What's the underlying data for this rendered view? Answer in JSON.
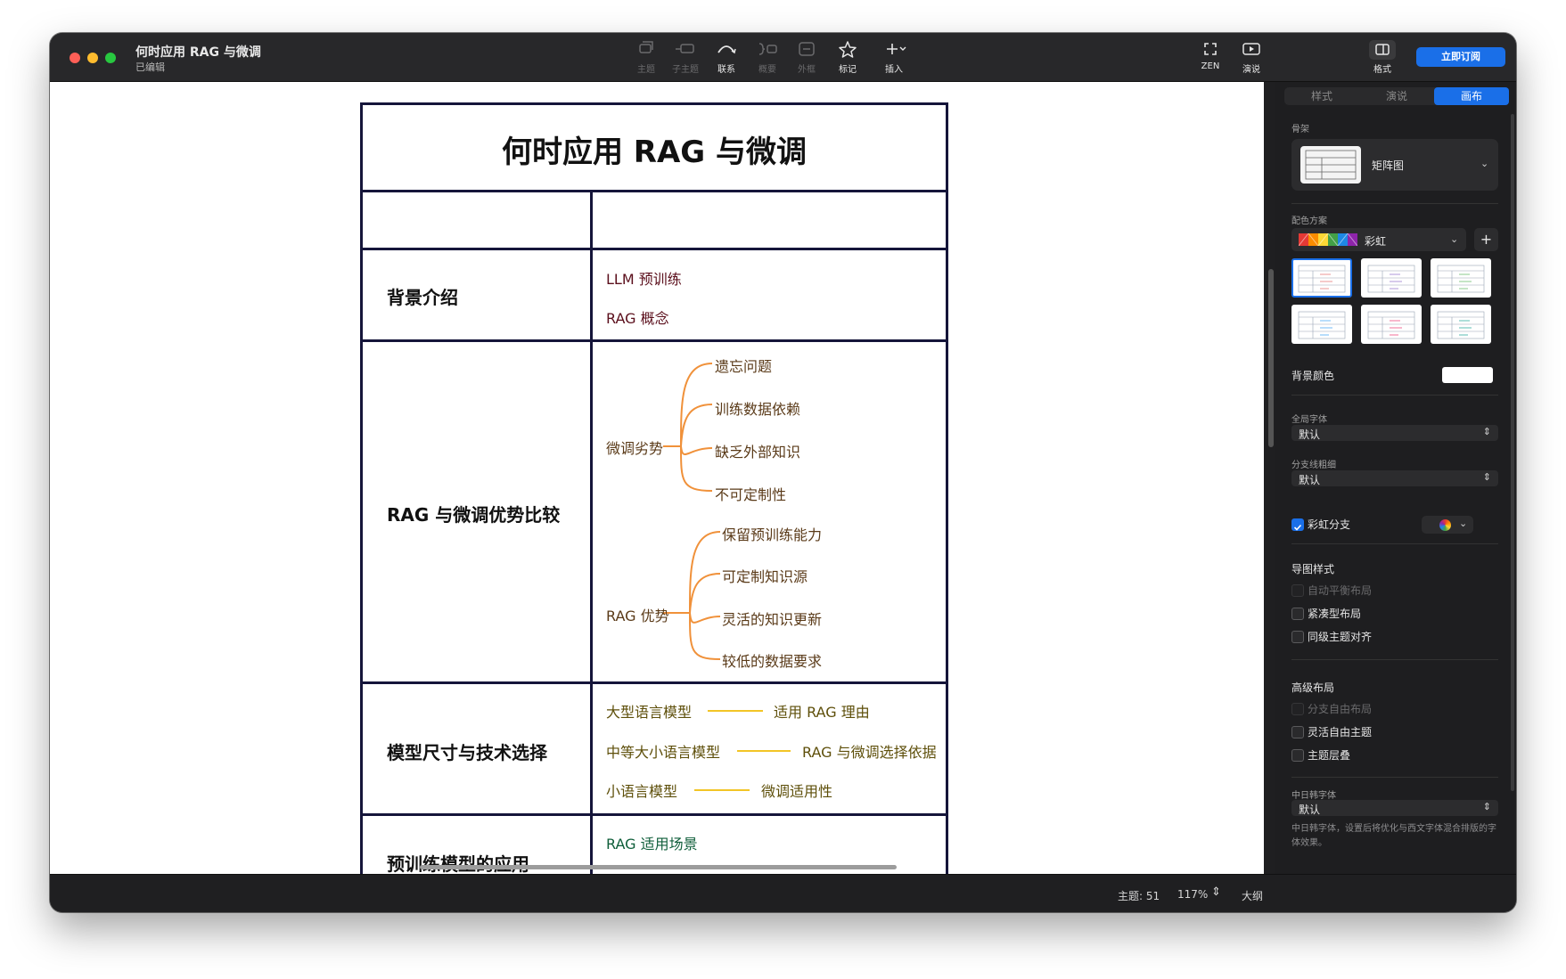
{
  "window": {
    "title": "何时应用 RAG 与微调",
    "subtitle": "已编辑"
  },
  "toolbar": {
    "items": [
      {
        "label": "主题",
        "icon": "topic-icon",
        "enabled": false
      },
      {
        "label": "子主题",
        "icon": "subtopic-icon",
        "enabled": false
      },
      {
        "label": "联系",
        "icon": "relationship-icon",
        "enabled": true
      },
      {
        "label": "概要",
        "icon": "summary-icon",
        "enabled": false
      },
      {
        "label": "外框",
        "icon": "boundary-icon",
        "enabled": false
      },
      {
        "label": "标记",
        "icon": "star-icon",
        "enabled": true
      },
      {
        "label": "插入",
        "icon": "plus-icon",
        "enabled": true
      }
    ],
    "zen_label": "ZEN",
    "present_label": "演说",
    "format_label": "格式",
    "subscribe_label": "立即订阅"
  },
  "matrix": {
    "title": "何时应用 RAG 与微调",
    "rows": [
      {
        "label": "背景介绍",
        "items": [
          "LLM 预训练",
          "RAG 概念"
        ]
      },
      {
        "label": "RAG 与微调优势比较",
        "groups": [
          {
            "name": "微调劣势",
            "children": [
              "遗忘问题",
              "训练数据依赖",
              "缺乏外部知识",
              "不可定制性"
            ]
          },
          {
            "name": "RAG 优势",
            "children": [
              "保留预训练能力",
              "可定制知识源",
              "灵活的知识更新",
              "较低的数据要求"
            ]
          }
        ]
      },
      {
        "label": "模型尺寸与技术选择",
        "pairs": [
          {
            "left": "大型语言模型",
            "right": "适用 RAG 理由"
          },
          {
            "left": "中等大小语言模型",
            "right": "RAG 与微调选择依据"
          },
          {
            "left": "小语言模型",
            "right": "微调适用性"
          }
        ]
      },
      {
        "label": "预训练模型的应用",
        "items": [
          "RAG 适用场景"
        ]
      }
    ],
    "branch_colors": {
      "dark_red": "#5b0f1c",
      "orange": "#f0913a",
      "yellow": "#f2c526",
      "green": "#0f5e3a"
    }
  },
  "status": {
    "topics": "主题: 51",
    "zoom": "117%",
    "outline": "大纲"
  },
  "sidebar": {
    "tabs": [
      "样式",
      "演说",
      "画布"
    ],
    "active_tab": "画布",
    "skeleton_label": "骨架",
    "skeleton_value": "矩阵图",
    "color_scheme_label": "配色方案",
    "color_scheme_value": "彩虹",
    "background_color_label": "背景颜色",
    "background_color_value": "#ffffff",
    "global_font_label": "全局字体",
    "global_font_value": "默认",
    "branch_width_label": "分支线粗细",
    "branch_width_value": "默认",
    "rainbow_branch_label": "彩虹分支",
    "rainbow_branch_checked": true,
    "map_style_label": "导图样式",
    "map_style_options": [
      {
        "label": "自动平衡布局",
        "checked": false,
        "enabled": false
      },
      {
        "label": "紧凑型布局",
        "checked": false,
        "enabled": true
      },
      {
        "label": "同级主题对齐",
        "checked": false,
        "enabled": true
      }
    ],
    "advanced_layout_label": "高级布局",
    "advanced_layout_options": [
      {
        "label": "分支自由布局",
        "checked": false,
        "enabled": false
      },
      {
        "label": "灵活自由主题",
        "checked": false,
        "enabled": true
      },
      {
        "label": "主题层叠",
        "checked": false,
        "enabled": true
      }
    ],
    "cjk_font_label": "中日韩字体",
    "cjk_font_value": "默认",
    "cjk_font_note": "中日韩字体，设置后将优化与西文字体混合排版的字体效果。"
  }
}
